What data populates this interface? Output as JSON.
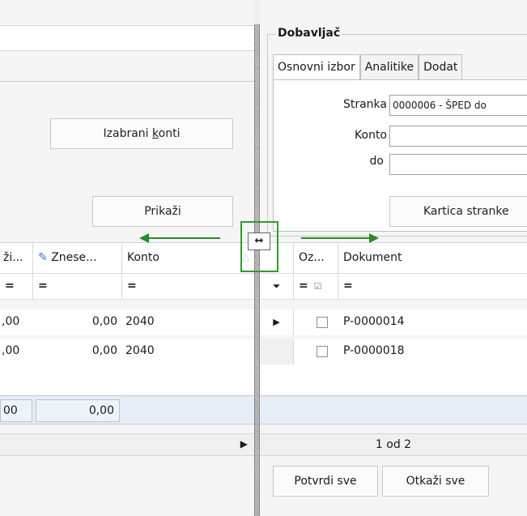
{
  "left": {
    "buttons": {
      "selected_accounts_prefix": "Izabrani ",
      "selected_accounts_key": "k",
      "selected_accounts_suffix": "onti",
      "show": "Prikaži"
    },
    "columns": [
      "ži...",
      "Znese...",
      "Konto"
    ],
    "rows": [
      {
        "c1": ",00",
        "amount": "0,00",
        "konto": "2040"
      },
      {
        "c1": ",00",
        "amount": "0,00",
        "konto": "2040"
      }
    ],
    "totals": {
      "c1": "00",
      "amount": "0,00"
    }
  },
  "right": {
    "group_title": "Dobavljač",
    "tabs": [
      "Osnovni izbor",
      "Analitike",
      "Dodat"
    ],
    "form": {
      "stranka_label": "Stranka",
      "stranka_value": "0000006 - ŠPED do",
      "konto_label": "Konto",
      "konto_value": "",
      "do_label": "do",
      "do_value": ""
    },
    "buttons": {
      "partner_card": "Kartica stranke",
      "confirm_all": "Potvrdi sve",
      "cancel_all": "Otkaži sve"
    },
    "columns": [
      "Oz...",
      "Dokument"
    ],
    "rows": [
      {
        "document": "P-0000014",
        "checked": false,
        "current": true
      },
      {
        "document": "P-0000018",
        "checked": false,
        "current": false
      }
    ],
    "pager": "1 od 2"
  },
  "filter_symbol": "=",
  "colors": {
    "highlight": "#2e9b2e",
    "arrow": "#2b8a2b",
    "total_bg": "#e6edf6"
  }
}
